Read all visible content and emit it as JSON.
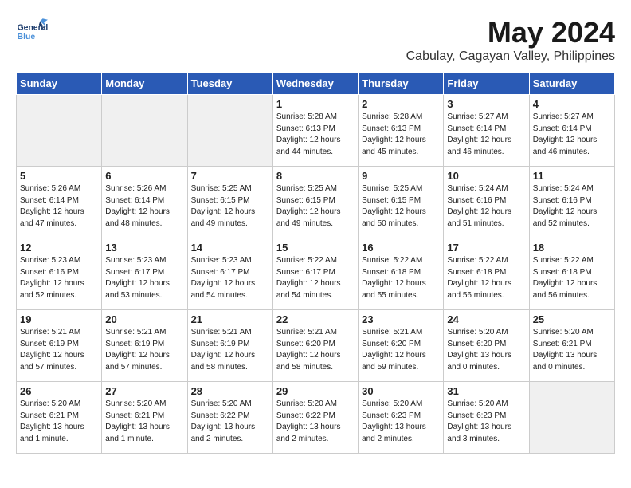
{
  "logo": {
    "line1": "General",
    "line2": "Blue"
  },
  "title": "May 2024",
  "subtitle": "Cabulay, Cagayan Valley, Philippines",
  "days_header": [
    "Sunday",
    "Monday",
    "Tuesday",
    "Wednesday",
    "Thursday",
    "Friday",
    "Saturday"
  ],
  "weeks": [
    [
      {
        "num": "",
        "info": ""
      },
      {
        "num": "",
        "info": ""
      },
      {
        "num": "",
        "info": ""
      },
      {
        "num": "1",
        "info": "Sunrise: 5:28 AM\nSunset: 6:13 PM\nDaylight: 12 hours\nand 44 minutes."
      },
      {
        "num": "2",
        "info": "Sunrise: 5:28 AM\nSunset: 6:13 PM\nDaylight: 12 hours\nand 45 minutes."
      },
      {
        "num": "3",
        "info": "Sunrise: 5:27 AM\nSunset: 6:14 PM\nDaylight: 12 hours\nand 46 minutes."
      },
      {
        "num": "4",
        "info": "Sunrise: 5:27 AM\nSunset: 6:14 PM\nDaylight: 12 hours\nand 46 minutes."
      }
    ],
    [
      {
        "num": "5",
        "info": "Sunrise: 5:26 AM\nSunset: 6:14 PM\nDaylight: 12 hours\nand 47 minutes."
      },
      {
        "num": "6",
        "info": "Sunrise: 5:26 AM\nSunset: 6:14 PM\nDaylight: 12 hours\nand 48 minutes."
      },
      {
        "num": "7",
        "info": "Sunrise: 5:25 AM\nSunset: 6:15 PM\nDaylight: 12 hours\nand 49 minutes."
      },
      {
        "num": "8",
        "info": "Sunrise: 5:25 AM\nSunset: 6:15 PM\nDaylight: 12 hours\nand 49 minutes."
      },
      {
        "num": "9",
        "info": "Sunrise: 5:25 AM\nSunset: 6:15 PM\nDaylight: 12 hours\nand 50 minutes."
      },
      {
        "num": "10",
        "info": "Sunrise: 5:24 AM\nSunset: 6:16 PM\nDaylight: 12 hours\nand 51 minutes."
      },
      {
        "num": "11",
        "info": "Sunrise: 5:24 AM\nSunset: 6:16 PM\nDaylight: 12 hours\nand 52 minutes."
      }
    ],
    [
      {
        "num": "12",
        "info": "Sunrise: 5:23 AM\nSunset: 6:16 PM\nDaylight: 12 hours\nand 52 minutes."
      },
      {
        "num": "13",
        "info": "Sunrise: 5:23 AM\nSunset: 6:17 PM\nDaylight: 12 hours\nand 53 minutes."
      },
      {
        "num": "14",
        "info": "Sunrise: 5:23 AM\nSunset: 6:17 PM\nDaylight: 12 hours\nand 54 minutes."
      },
      {
        "num": "15",
        "info": "Sunrise: 5:22 AM\nSunset: 6:17 PM\nDaylight: 12 hours\nand 54 minutes."
      },
      {
        "num": "16",
        "info": "Sunrise: 5:22 AM\nSunset: 6:18 PM\nDaylight: 12 hours\nand 55 minutes."
      },
      {
        "num": "17",
        "info": "Sunrise: 5:22 AM\nSunset: 6:18 PM\nDaylight: 12 hours\nand 56 minutes."
      },
      {
        "num": "18",
        "info": "Sunrise: 5:22 AM\nSunset: 6:18 PM\nDaylight: 12 hours\nand 56 minutes."
      }
    ],
    [
      {
        "num": "19",
        "info": "Sunrise: 5:21 AM\nSunset: 6:19 PM\nDaylight: 12 hours\nand 57 minutes."
      },
      {
        "num": "20",
        "info": "Sunrise: 5:21 AM\nSunset: 6:19 PM\nDaylight: 12 hours\nand 57 minutes."
      },
      {
        "num": "21",
        "info": "Sunrise: 5:21 AM\nSunset: 6:19 PM\nDaylight: 12 hours\nand 58 minutes."
      },
      {
        "num": "22",
        "info": "Sunrise: 5:21 AM\nSunset: 6:20 PM\nDaylight: 12 hours\nand 58 minutes."
      },
      {
        "num": "23",
        "info": "Sunrise: 5:21 AM\nSunset: 6:20 PM\nDaylight: 12 hours\nand 59 minutes."
      },
      {
        "num": "24",
        "info": "Sunrise: 5:20 AM\nSunset: 6:20 PM\nDaylight: 13 hours\nand 0 minutes."
      },
      {
        "num": "25",
        "info": "Sunrise: 5:20 AM\nSunset: 6:21 PM\nDaylight: 13 hours\nand 0 minutes."
      }
    ],
    [
      {
        "num": "26",
        "info": "Sunrise: 5:20 AM\nSunset: 6:21 PM\nDaylight: 13 hours\nand 1 minute."
      },
      {
        "num": "27",
        "info": "Sunrise: 5:20 AM\nSunset: 6:21 PM\nDaylight: 13 hours\nand 1 minute."
      },
      {
        "num": "28",
        "info": "Sunrise: 5:20 AM\nSunset: 6:22 PM\nDaylight: 13 hours\nand 2 minutes."
      },
      {
        "num": "29",
        "info": "Sunrise: 5:20 AM\nSunset: 6:22 PM\nDaylight: 13 hours\nand 2 minutes."
      },
      {
        "num": "30",
        "info": "Sunrise: 5:20 AM\nSunset: 6:23 PM\nDaylight: 13 hours\nand 2 minutes."
      },
      {
        "num": "31",
        "info": "Sunrise: 5:20 AM\nSunset: 6:23 PM\nDaylight: 13 hours\nand 3 minutes."
      },
      {
        "num": "",
        "info": ""
      }
    ]
  ]
}
